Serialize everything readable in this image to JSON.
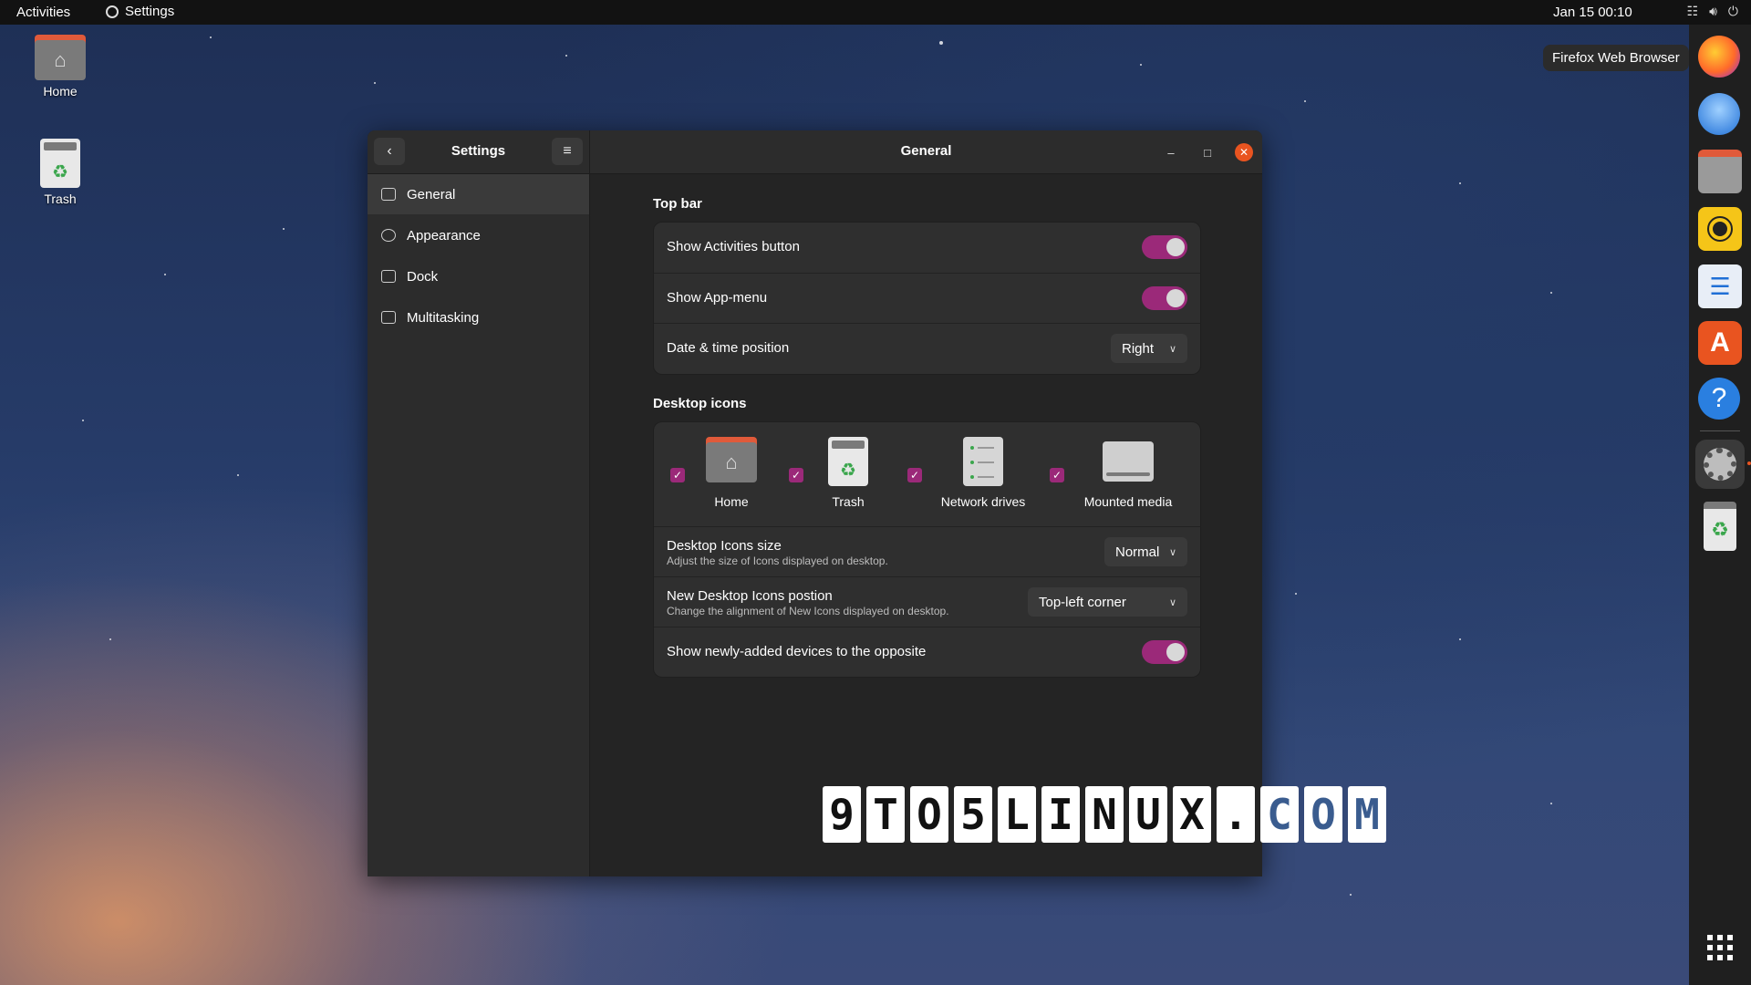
{
  "topbar": {
    "activities": "Activities",
    "app_name": "Settings",
    "clock": "Jan 15  00:10"
  },
  "desktop": {
    "home_label": "Home",
    "trash_label": "Trash"
  },
  "dock": {
    "tooltip": "Firefox Web Browser"
  },
  "window": {
    "sidebar_title": "Settings",
    "main_title": "General",
    "nav": [
      {
        "label": "General"
      },
      {
        "label": "Appearance"
      },
      {
        "label": "Dock"
      },
      {
        "label": "Multitasking"
      }
    ]
  },
  "topbar_section": {
    "title": "Top bar",
    "show_activities": "Show Activities button",
    "show_app_menu": "Show App-menu",
    "date_time_label": "Date & time position",
    "date_time_value": "Right"
  },
  "desktop_icons": {
    "title": "Desktop icons",
    "options": [
      {
        "label": "Home"
      },
      {
        "label": "Trash"
      },
      {
        "label": "Network drives"
      },
      {
        "label": "Mounted media"
      }
    ],
    "size_label": "Desktop Icons size",
    "size_sub": "Adjust the size of Icons displayed on desktop.",
    "size_value": "Normal",
    "position_label": "New Desktop Icons postion",
    "position_sub": "Change the alignment of New Icons displayed on desktop.",
    "position_value": "Top-left corner",
    "opposite_label": "Show newly-added devices to the opposite"
  },
  "watermark": {
    "chars": [
      "9",
      "T",
      "O",
      "5",
      "L",
      "I",
      "N",
      "U",
      "X",
      ".",
      "C",
      "O",
      "M"
    ]
  },
  "colors": {
    "accent": "#9b2979",
    "close": "#e95420"
  }
}
